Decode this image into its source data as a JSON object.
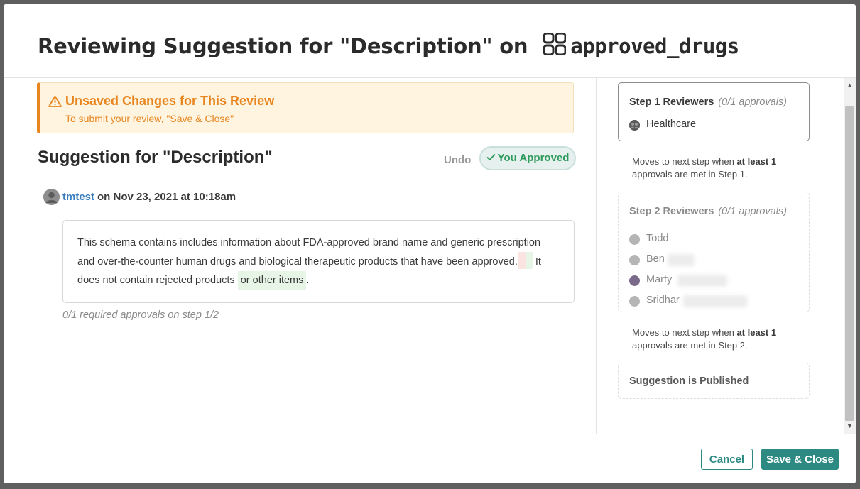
{
  "modal": {
    "title_prefix": "Reviewing Suggestion for \"Description\" on",
    "table_name": "approved_drugs"
  },
  "alert": {
    "title": "Unsaved Changes for This Review",
    "subtitle": "To submit your review, \"Save & Close\""
  },
  "suggestion": {
    "title": "Suggestion for \"Description\"",
    "undo_label": "Undo",
    "approved_label": "You Approved",
    "author": "tmtest",
    "date": "on Nov 23, 2021 at 10:18am",
    "text_part1": "This schema contains includes information about FDA-approved brand name and generic prescription and over-the-counter human drugs and biological therapeutic products that have been approved.",
    "text_part2": "It does not contain rejected products",
    "inserted_text": "or other items",
    "text_end": ".",
    "required_approvals": "0/1 required approvals on step 1/2"
  },
  "steps": {
    "step1": {
      "title": "Step 1 Reviewers",
      "approvals": "(0/1 approvals)",
      "reviewers": [
        "Healthcare"
      ]
    },
    "step1_note": {
      "prefix": "Moves to next step when",
      "bold": "at least 1",
      "suffix": "approvals are met in Step 1."
    },
    "step2": {
      "title": "Step 2 Reviewers",
      "approvals": "(0/1 approvals)",
      "reviewers": [
        "Todd",
        "Ben",
        "Marty",
        "Sridhar"
      ]
    },
    "step2_note": {
      "prefix": "Moves to next step when",
      "bold": "at least 1",
      "suffix": "approvals are met in Step 2."
    },
    "published": "Suggestion is Published"
  },
  "footer": {
    "cancel_label": "Cancel",
    "save_label": "Save & Close"
  },
  "colors": {
    "accent": "#2d8a82",
    "warning": "#e8851f",
    "approved": "#2e9a5b",
    "link": "#3a7ebf"
  }
}
